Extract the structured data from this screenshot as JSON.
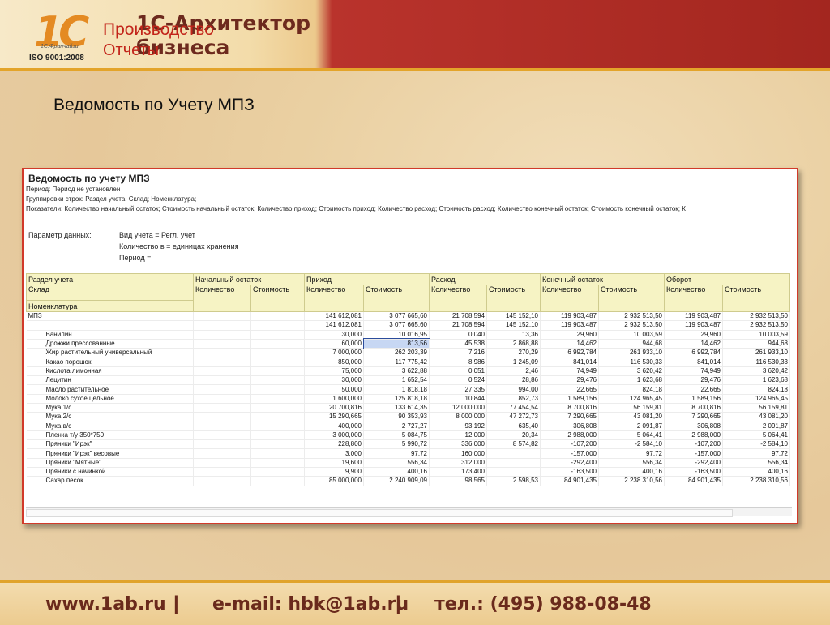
{
  "header": {
    "logo_mark": "1С",
    "logo_sub": "1С:Франчайзи",
    "logo_iso": "ISO 9001:2008",
    "brand_line1": "1С-Архитектор",
    "brand_line2": "бизнеса",
    "section": "Производство",
    "subsection": "Отчеты"
  },
  "page_title": "Ведомость по Учету МПЗ",
  "report": {
    "title": "Ведомость по учету МПЗ",
    "period": "Период: Период не установлен",
    "grouping": "Группировки строк: Раздел учета; Склад; Номенклатура;",
    "indicators": "Показатели: Количество начальный остаток; Стоимость начальный остаток; Количество приход; Стоимость приход; Количество расход; Стоимость расход; Количество конечный остаток; Стоимость конечный остаток; К",
    "params_label": "Параметр данных:",
    "params": [
      "Вид учета = Регл. учет",
      "Количество в = единицах хранения",
      "Период ="
    ],
    "header_row1": [
      "Раздел учета",
      "Начальный остаток",
      "Приход",
      "Расход",
      "Конечный остаток",
      "Оборот"
    ],
    "header_row2": [
      "Склад",
      "Количество",
      "Стоимость",
      "Количество",
      "Стоимость",
      "Количество",
      "Стоимость",
      "Количество",
      "Стоимость",
      "Количество",
      "Стоимость"
    ],
    "header_row3": "Номенклатура",
    "rows": [
      {
        "name": "МПЗ",
        "v": [
          "",
          "",
          "141 612,081",
          "3 077 665,60",
          "21 708,594",
          "145 152,10",
          "119 903,487",
          "2 932 513,50",
          "119 903,487",
          "2 932 513,50"
        ]
      },
      {
        "name": "",
        "v": [
          "",
          "",
          "141 612,081",
          "3 077 665,60",
          "21 708,594",
          "145 152,10",
          "119 903,487",
          "2 932 513,50",
          "119 903,487",
          "2 932 513,50"
        ]
      },
      {
        "name": "Ванилин",
        "v": [
          "",
          "",
          "30,000",
          "10 016,95",
          "0,040",
          "13,36",
          "29,960",
          "10 003,59",
          "29,960",
          "10 003,59"
        ]
      },
      {
        "name": "Дрожжи прессованные",
        "v": [
          "",
          "",
          "60,000",
          "813,56",
          "45,538",
          "2 868,88",
          "14,462",
          "944,68",
          "14,462",
          "944,68"
        ]
      },
      {
        "name": "Жир растительный универсальный",
        "v": [
          "",
          "",
          "7 000,000",
          "262 203,39",
          "7,216",
          "270,29",
          "6 992,784",
          "261 933,10",
          "6 992,784",
          "261 933,10"
        ]
      },
      {
        "name": "Какао порошок",
        "v": [
          "",
          "",
          "850,000",
          "117 775,42",
          "8,986",
          "1 245,09",
          "841,014",
          "116 530,33",
          "841,014",
          "116 530,33"
        ]
      },
      {
        "name": "Кислота лимонная",
        "v": [
          "",
          "",
          "75,000",
          "3 622,88",
          "0,051",
          "2,46",
          "74,949",
          "3 620,42",
          "74,949",
          "3 620,42"
        ]
      },
      {
        "name": "Лецитин",
        "v": [
          "",
          "",
          "30,000",
          "1 652,54",
          "0,524",
          "28,86",
          "29,476",
          "1 623,68",
          "29,476",
          "1 623,68"
        ]
      },
      {
        "name": "Масло растительное",
        "v": [
          "",
          "",
          "50,000",
          "1 818,18",
          "27,335",
          "994,00",
          "22,665",
          "824,18",
          "22,665",
          "824,18"
        ]
      },
      {
        "name": "Молоко сухое цельное",
        "v": [
          "",
          "",
          "1 600,000",
          "125 818,18",
          "10,844",
          "852,73",
          "1 589,156",
          "124 965,45",
          "1 589,156",
          "124 965,45"
        ]
      },
      {
        "name": "Мука 1/с",
        "v": [
          "",
          "",
          "20 700,816",
          "133 614,35",
          "12 000,000",
          "77 454,54",
          "8 700,816",
          "56 159,81",
          "8 700,816",
          "56 159,81"
        ]
      },
      {
        "name": "Мука 2/с",
        "v": [
          "",
          "",
          "15 290,665",
          "90 353,93",
          "8 000,000",
          "47 272,73",
          "7 290,665",
          "43 081,20",
          "7 290,665",
          "43 081,20"
        ]
      },
      {
        "name": "Мука в/с",
        "v": [
          "",
          "",
          "400,000",
          "2 727,27",
          "93,192",
          "635,40",
          "306,808",
          "2 091,87",
          "306,808",
          "2 091,87"
        ]
      },
      {
        "name": "Пленка т/у 350*750",
        "v": [
          "",
          "",
          "3 000,000",
          "5 084,75",
          "12,000",
          "20,34",
          "2 988,000",
          "5 064,41",
          "2 988,000",
          "5 064,41"
        ]
      },
      {
        "name": "Пряники \"Ирэк\"",
        "v": [
          "",
          "",
          "228,800",
          "5 990,72",
          "336,000",
          "8 574,82",
          "-107,200",
          "-2 584,10",
          "-107,200",
          "-2 584,10"
        ]
      },
      {
        "name": "Пряники \"Ирэк\" весовые",
        "v": [
          "",
          "",
          "3,000",
          "97,72",
          "160,000",
          "",
          "-157,000",
          "97,72",
          "-157,000",
          "97,72"
        ]
      },
      {
        "name": "Пряники \"Мятные\"",
        "v": [
          "",
          "",
          "19,600",
          "556,34",
          "312,000",
          "",
          "-292,400",
          "556,34",
          "-292,400",
          "556,34"
        ]
      },
      {
        "name": "Пряники с начинкой",
        "v": [
          "",
          "",
          "9,900",
          "400,16",
          "173,400",
          "",
          "-163,500",
          "400,16",
          "-163,500",
          "400,16"
        ]
      },
      {
        "name": "Сахар песок",
        "v": [
          "",
          "",
          "85 000,000",
          "2 240 909,09",
          "98,565",
          "2 598,53",
          "84 901,435",
          "2 238 310,56",
          "84 901,435",
          "2 238 310,56"
        ]
      }
    ],
    "selected_cell": "813,56"
  },
  "footer": {
    "site": "www.1ab.ru",
    "email": "e-mail: hbk@1ab.ru",
    "phone": "тел.: (495) 988-08-48",
    "separator": "|"
  }
}
